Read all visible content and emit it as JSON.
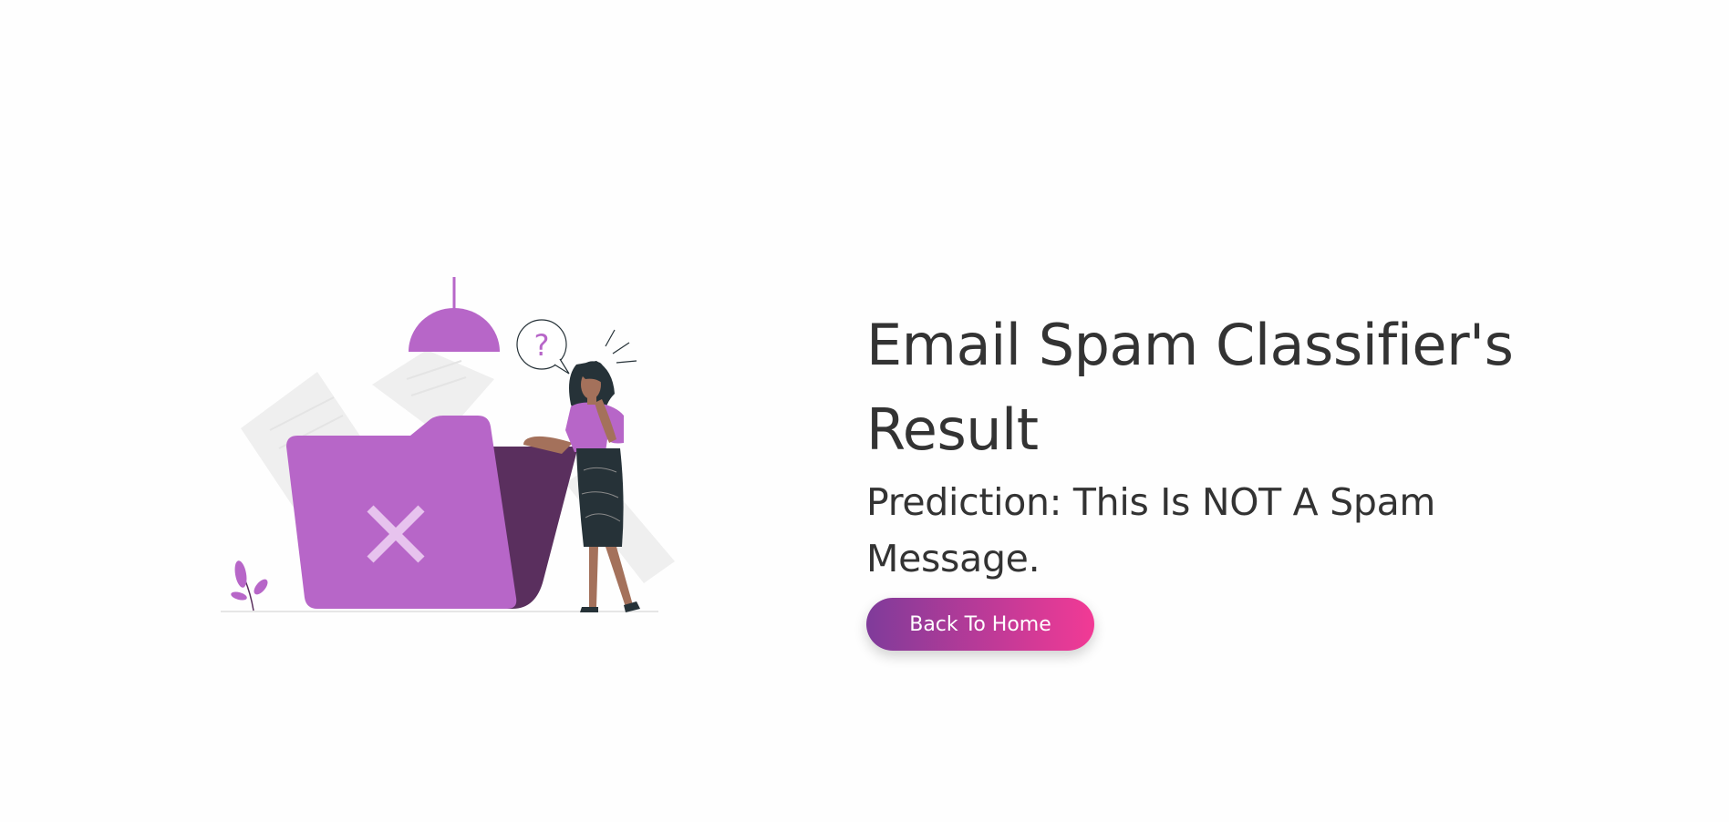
{
  "result": {
    "title": "Email Spam Classifier's Result",
    "prediction": "Prediction: This Is NOT A Spam Message.",
    "back_button_label": "Back To Home"
  },
  "illustration": {
    "name": "confused-person-with-folder-illustration",
    "speech_bubble_symbol": "?",
    "colors": {
      "accent": "#b766c8",
      "dark_accent": "#5a2f5e",
      "paper": "#efefef",
      "skirt": "#263238",
      "skin": "#a4715b"
    }
  },
  "theme": {
    "button_gradient_start": "#7f3b9a",
    "button_gradient_end": "#f23a95",
    "text_color": "#333333"
  }
}
